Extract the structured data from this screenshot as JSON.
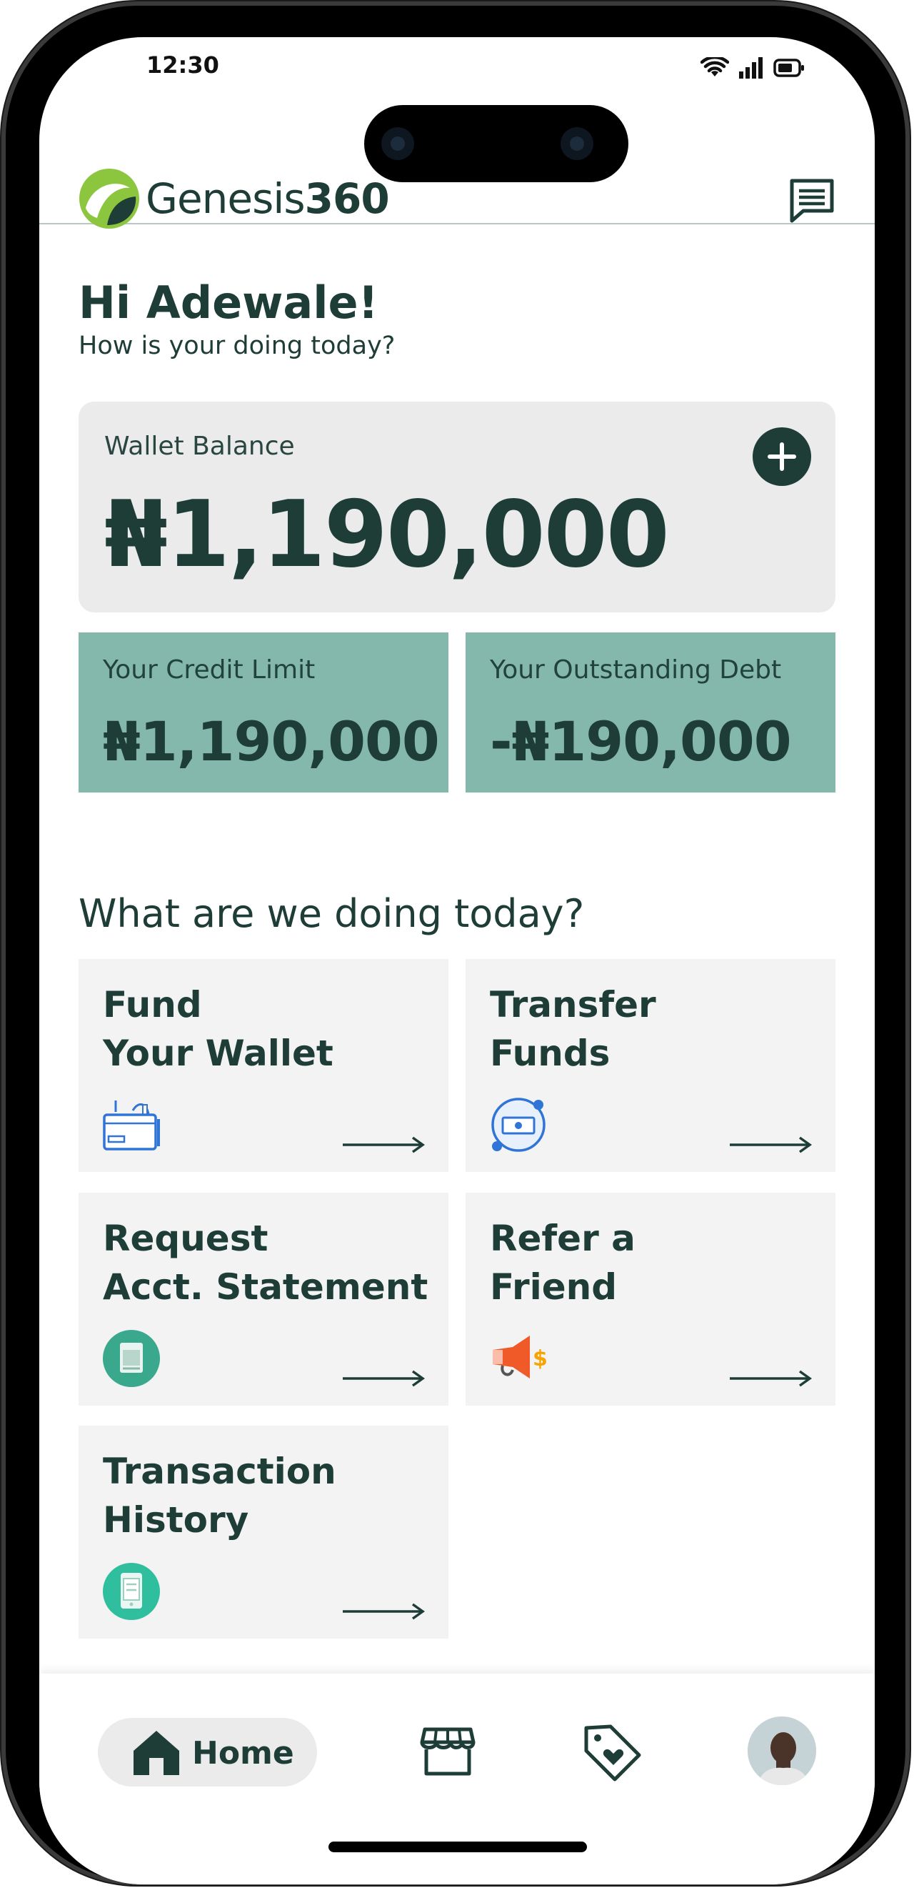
{
  "status_bar": {
    "time": "12:30"
  },
  "header": {
    "logo_prefix": "Genesis",
    "logo_suffix": "360",
    "chat_icon": "chat-message-icon"
  },
  "greeting": {
    "title": "Hi Adewale!",
    "subtitle": "How is your doing today?"
  },
  "wallet": {
    "label": "Wallet Balance",
    "amount": "₦1,190,000",
    "add_icon": "plus-icon"
  },
  "credit": {
    "limit_label": "Your Credit Limit",
    "limit_amount": "₦1,190,000",
    "debt_label": "Your Outstanding Debt",
    "debt_amount": "-₦190,000"
  },
  "actions": {
    "section_title": "What are we doing today?",
    "tiles": [
      {
        "title": "Fund\nYour Wallet",
        "icon": "wallet-icon"
      },
      {
        "title": "Transfer\nFunds",
        "icon": "money-transfer-icon"
      },
      {
        "title": "Request\nAcct. Statement",
        "icon": "statement-icon"
      },
      {
        "title": "Refer a\nFriend",
        "icon": "megaphone-icon"
      },
      {
        "title": "Transaction\nHistory",
        "icon": "receipt-phone-icon"
      }
    ]
  },
  "bottom_nav": {
    "home_label": "Home",
    "items": [
      "home-icon",
      "store-icon",
      "tag-heart-icon",
      "avatar"
    ]
  },
  "colors": {
    "primary": "#1e3d37",
    "credit_card": "#84b8ac",
    "tile_bg": "#f3f3f3",
    "wallet_bg": "#ebebeb",
    "logo_green": "#8cc63f"
  }
}
